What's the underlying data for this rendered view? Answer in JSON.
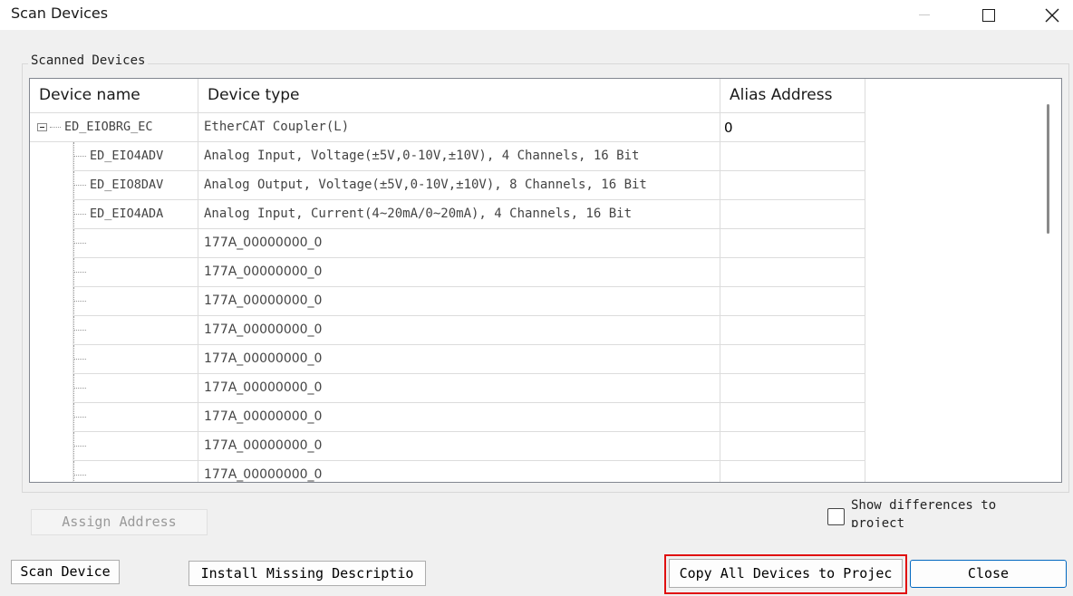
{
  "window": {
    "title": "Scan Devices"
  },
  "group": {
    "label": "Scanned Devices"
  },
  "grid": {
    "headers": [
      "Device name",
      "Device type",
      "Alias Address"
    ],
    "root": {
      "name": "ED_EIOBRG_EC",
      "type": "EtherCAT Coupler(L)",
      "alias": "0",
      "expanded": true
    },
    "children": [
      {
        "name": "ED_EIO4ADV",
        "type": "Analog Input, Voltage(±5V,0-10V,±10V), 4 Channels, 16 Bit",
        "alias": ""
      },
      {
        "name": "ED_EIO8DAV",
        "type": "Analog Output, Voltage(±5V,0-10V,±10V), 8 Channels, 16 Bit",
        "alias": ""
      },
      {
        "name": "ED_EIO4ADA",
        "type": "Analog Input, Current(4~20mA/0~20mA), 4 Channels, 16 Bit",
        "alias": ""
      },
      {
        "name": "",
        "type": "177A_00000000_0",
        "alias": ""
      },
      {
        "name": "",
        "type": "177A_00000000_0",
        "alias": ""
      },
      {
        "name": "",
        "type": "177A_00000000_0",
        "alias": ""
      },
      {
        "name": "",
        "type": "177A_00000000_0",
        "alias": ""
      },
      {
        "name": "",
        "type": "177A_00000000_0",
        "alias": ""
      },
      {
        "name": "",
        "type": "177A_00000000_0",
        "alias": ""
      },
      {
        "name": "",
        "type": "177A_00000000_0",
        "alias": ""
      },
      {
        "name": "",
        "type": "177A_00000000_0",
        "alias": ""
      },
      {
        "name": "",
        "type": "177A_00000000_0",
        "alias": ""
      }
    ]
  },
  "buttons": {
    "assign_address": "Assign Address",
    "scan_device": "Scan Device",
    "install_missing": "Install Missing Descriptio",
    "copy_all": "Copy All Devices to Projec",
    "close": "Close"
  },
  "options": {
    "show_differences_label": "Show differences to project",
    "show_differences_checked": false
  },
  "colors": {
    "highlight": "#e01010",
    "default_button_border": "#0067c0"
  },
  "icons": {
    "minimize": "minimize-icon",
    "maximize": "maximize-icon",
    "close": "close-icon",
    "tree_collapse": "tree-collapse-icon"
  }
}
